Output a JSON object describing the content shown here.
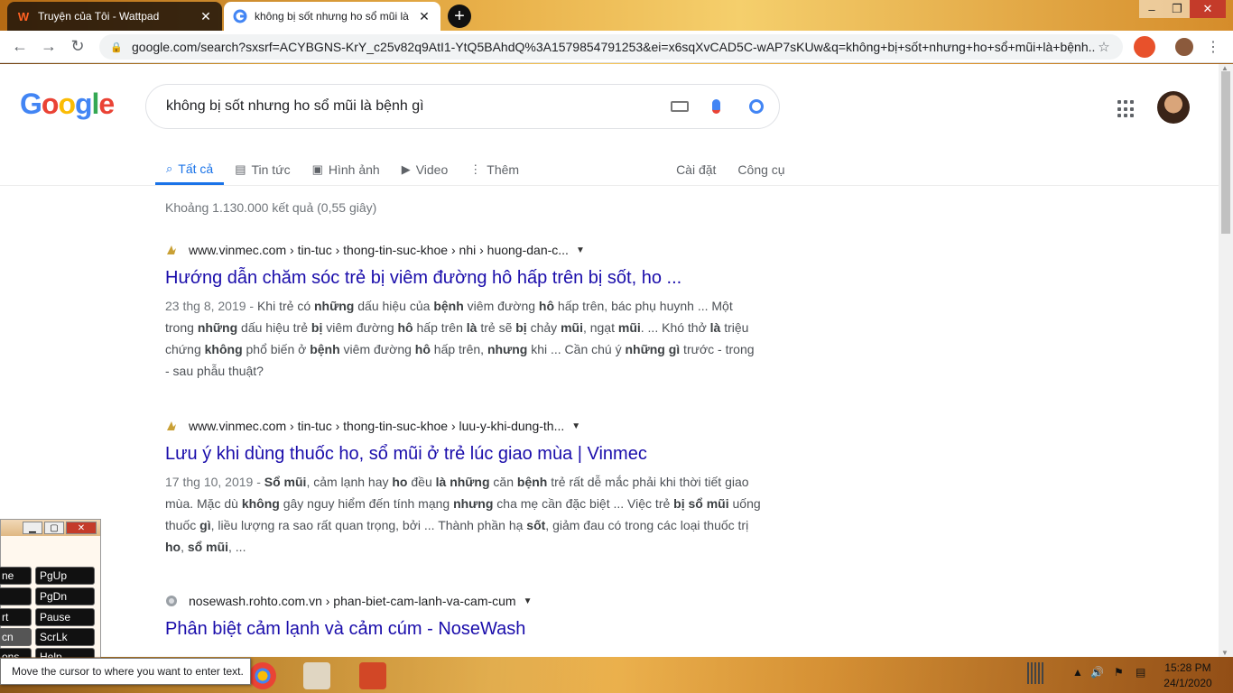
{
  "browser": {
    "tabs": [
      {
        "title": "Truyện của Tôi - Wattpad",
        "favicon": "W"
      },
      {
        "title": "không bị sốt nhưng ho sổ mũi là"
      }
    ],
    "new_tab": "+",
    "url": "google.com/search?sxsrf=ACYBGNS-KrY_c25v82q9AtI1-YtQ5BAhdQ%3A1579854791253&ei=x6sqXvCAD5C-wAP7sKUw&q=không+bị+sốt+nhưng+ho+sổ+mũi+là+bệnh...",
    "window_controls": {
      "minimize": "–",
      "maximize": "❐",
      "close": "✕"
    }
  },
  "google": {
    "logo": [
      "G",
      "o",
      "o",
      "g",
      "l",
      "e"
    ],
    "query": "không bị sốt nhưng ho sổ mũi là bệnh gì",
    "tabs": [
      {
        "label": "Tất cả",
        "icon": "search-icon"
      },
      {
        "label": "Tin tức",
        "icon": "news-icon"
      },
      {
        "label": "Hình ảnh",
        "icon": "image-icon"
      },
      {
        "label": "Video",
        "icon": "video-icon"
      },
      {
        "label": "Thêm",
        "icon": "more-icon"
      }
    ],
    "tools": [
      "Cài đặt",
      "Công cụ"
    ],
    "stats": "Khoảng 1.130.000 kết quả (0,55 giây)",
    "results": [
      {
        "cite": "www.vinmec.com › tin-tuc › thong-tin-suc-khoe › nhi › huong-dan-c...",
        "title": "Hướng dẫn chăm sóc trẻ bị viêm đường hô hấp trên bị sốt, ho ...",
        "date": "23 thg 8, 2019 - ",
        "snippet_html": "Khi trẻ có <b>những</b> dấu hiệu của <b>bệnh</b> viêm đường <b>hô</b> hấp trên, bác phụ huynh ... Một trong <b>những</b> dấu hiệu trẻ <b>bị</b> viêm đường <b>hô</b> hấp trên <b>là</b> trẻ sẽ <b>bị</b> chảy <b>mũi</b>, ngạt <b>mũi</b>. ... Khó thở <b>là</b> triệu chứng <b>không</b> phổ biến ở <b>bệnh</b> viêm đường <b>hô</b> hấp trên, <b>nhưng</b> khi ... Cần chú ý <b>những gì</b> trước - trong - sau phẫu thuật?"
      },
      {
        "cite": "www.vinmec.com › tin-tuc › thong-tin-suc-khoe › luu-y-khi-dung-th...",
        "title": "Lưu ý khi dùng thuốc ho, sổ mũi ở trẻ lúc giao mùa | Vinmec",
        "date": "17 thg 10, 2019 - ",
        "snippet_html": "<b>Sổ mũi</b>, cảm lạnh hay <b>ho</b> đều <b>là những</b> căn <b>bệnh</b> trẻ rất dễ mắc phải khi thời tiết giao mùa. Mặc dù <b>không</b> gây nguy hiểm đến tính mạng <b>nhưng</b> cha mẹ cần đặc biệt ... Việc trẻ <b>bị sổ mũi</b> uống thuốc <b>gì</b>, liều lượng ra sao rất quan trọng, bởi ... Thành phần hạ <b>sốt</b>, giảm đau có trong các loại thuốc trị <b>ho</b>, <b>sổ mũi</b>, ..."
      },
      {
        "cite": "nosewash.rohto.com.vn › phan-biet-cam-lanh-va-cam-cum",
        "title": "Phân biệt cảm lạnh và cảm cúm - NoseWash",
        "date": "",
        "snippet_html": ""
      }
    ]
  },
  "osk": {
    "keys": [
      "ne",
      "PgUp",
      "",
      "PgDn",
      "rt",
      "Pause",
      "cn",
      "ScrLk",
      "ons",
      "Help"
    ]
  },
  "tooltip": "Move the cursor to where you want to enter text.",
  "clock": {
    "time": "15:28 PM",
    "date": "24/1/2020"
  },
  "colors": {
    "link": "#1a0dab",
    "accent": "#1a73e8"
  }
}
